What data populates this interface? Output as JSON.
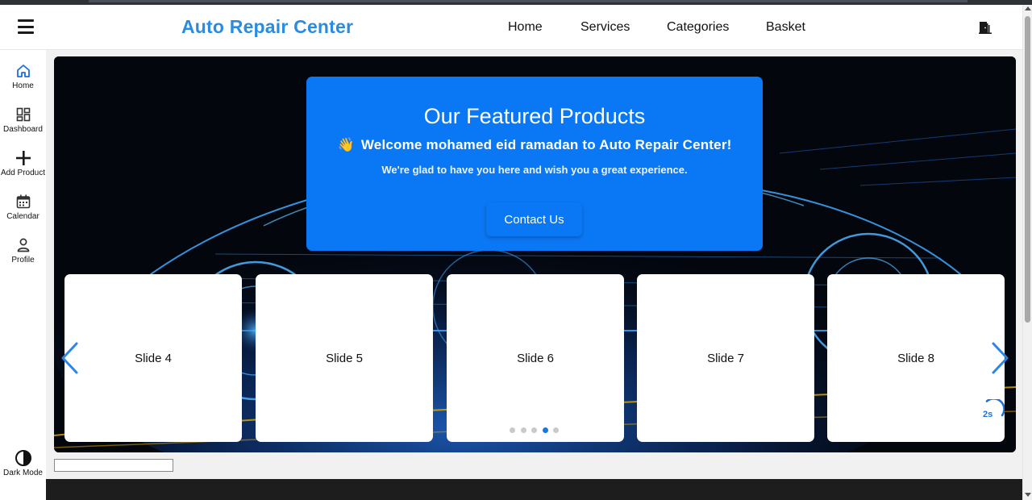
{
  "header": {
    "brand": "Auto Repair Center",
    "nav": [
      "Home",
      "Services",
      "Categories",
      "Basket"
    ],
    "icons": {
      "menu": "hamburger-icon",
      "logout": "logout-door-icon"
    }
  },
  "sidebar": {
    "items": [
      {
        "label": "Home",
        "icon": "home-icon",
        "active": true
      },
      {
        "label": "Dashboard",
        "icon": "dashboard-grid-icon",
        "active": false
      },
      {
        "label": "Add Product",
        "icon": "plus-icon",
        "active": false
      },
      {
        "label": "Calendar",
        "icon": "calendar-icon",
        "active": false
      },
      {
        "label": "Profile",
        "icon": "user-icon",
        "active": false
      }
    ],
    "dark_mode_label": "Dark Mode"
  },
  "hero": {
    "title": "Our Featured Products",
    "welcome_emoji": "👋",
    "welcome": "Welcome mohamed eid ramadan to Auto Repair Center!",
    "subtitle": "We're glad to have you here and wish you a great experience.",
    "cta": "Contact Us"
  },
  "carousel": {
    "slides": [
      "Slide 4",
      "Slide 5",
      "Slide 6",
      "Slide 7",
      "Slide 8"
    ],
    "dot_count": 5,
    "active_dot": 3,
    "autoplay_label": "2s"
  },
  "colors": {
    "brand": "#2a8be0",
    "card_blue": "#0a78f5",
    "arrow_blue": "#2b86e8",
    "hero_bg": "#03060d",
    "footer": "#1d1d1d"
  }
}
